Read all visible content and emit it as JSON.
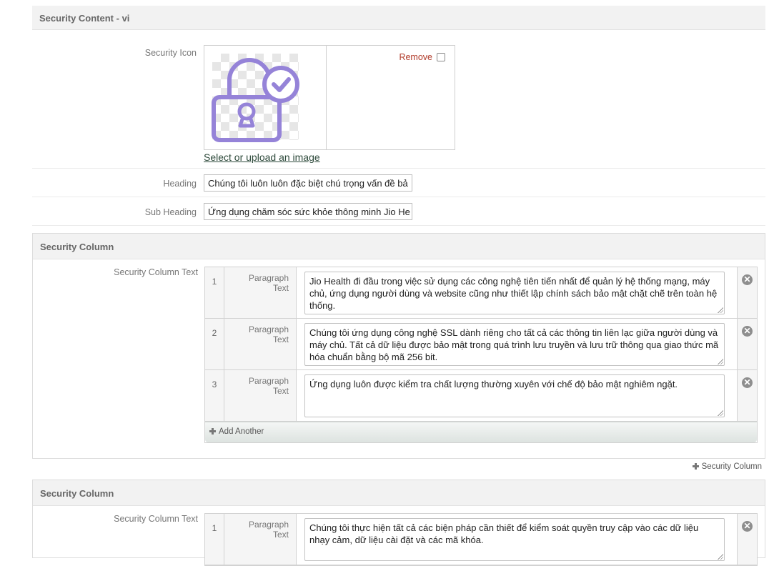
{
  "section_title": "Security Content - vi",
  "security_icon": {
    "label": "Security Icon",
    "remove_label": "Remove",
    "upload_link": "Select or upload an image",
    "icon_color": "#9583d8"
  },
  "heading": {
    "label": "Heading",
    "value": "Chúng tôi luôn luôn đặc biệt chú trọng vấn đề bả"
  },
  "sub_heading": {
    "label": "Sub Heading",
    "value": "Ứng dụng chăm sóc sức khỏe thông minh Jio He"
  },
  "columns": [
    {
      "title": "Security Column",
      "field_label": "Security Column Text",
      "rows": [
        {
          "num": "1",
          "label_line1": "Paragraph",
          "label_line2": "Text",
          "text": "Jio Health đi đầu trong việc sử dụng các công nghệ tiên tiến nhất để quản lý hệ thống mạng, máy chủ, ứng dụng người dùng và website cũng như thiết lập chính sách bảo mật chặt chẽ trên toàn hệ thống."
        },
        {
          "num": "2",
          "label_line1": "Paragraph",
          "label_line2": "Text",
          "text": "Chúng tôi ứng dụng công nghệ SSL dành riêng cho tất cả các thông tin liên lạc giữa người dùng và máy chủ. Tất cả dữ liệu được bảo mật trong quá trình lưu truyền và lưu trữ thông qua giao thức mã hóa chuẩn bằng bộ mã 256 bit."
        },
        {
          "num": "3",
          "label_line1": "Paragraph",
          "label_line2": "Text",
          "text": "Ứng dụng luôn được kiểm tra chất lượng thường xuyên với chế độ bảo mật nghiêm ngặt."
        }
      ],
      "add_another": "Add Another"
    },
    {
      "title": "Security Column",
      "field_label": "Security Column Text",
      "rows": [
        {
          "num": "1",
          "label_line1": "Paragraph",
          "label_line2": "Text",
          "text": "Chúng tôi thực hiện tất cả các biện pháp cần thiết để kiểm soát quyền truy cập vào các dữ liệu nhạy cảm, dữ liệu cài đặt và các mã khóa."
        }
      ]
    }
  ],
  "add_column_label": "Security Column"
}
